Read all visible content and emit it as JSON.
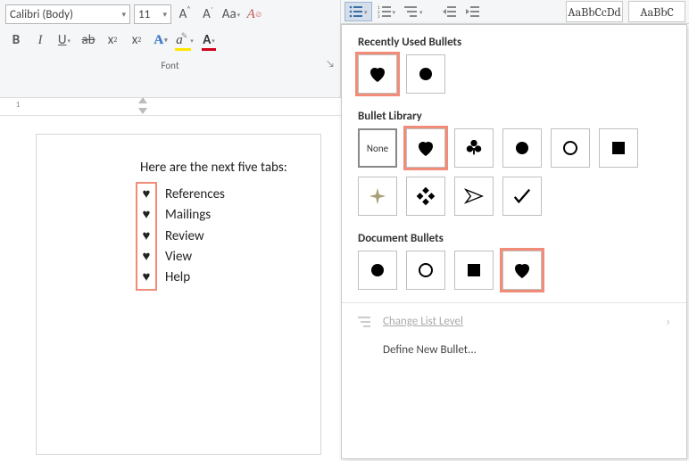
{
  "ribbon": {
    "font_name": "Calibri (Body)",
    "font_size": "11",
    "group_label": "Font",
    "bold": "B",
    "italic": "I",
    "underline": "U",
    "strike": "ab",
    "sub": "x",
    "sup": "x"
  },
  "styles": {
    "preview1": "AaBbCcDd",
    "preview2": "AaBbC"
  },
  "document": {
    "intro": "Here are the next five tabs:",
    "bullets": [
      "References",
      "Mailings",
      "Review",
      "View",
      "Help"
    ],
    "bullet_char": "♥"
  },
  "ruler": {
    "num1": "1"
  },
  "popup": {
    "recent_title": "Recently Used Bullets",
    "library_title": "Bullet Library",
    "doc_title": "Document Bullets",
    "none_label": "None",
    "change_level": "Change List Level",
    "define_new": "Define New Bullet...",
    "recent": [
      "♥",
      "●"
    ],
    "library": [
      "None",
      "♥",
      "♣",
      "●",
      "○",
      "■",
      "✦",
      "❖",
      "➢",
      "✓"
    ],
    "doc_bullets": [
      "●",
      "○",
      "■",
      "♥"
    ]
  }
}
